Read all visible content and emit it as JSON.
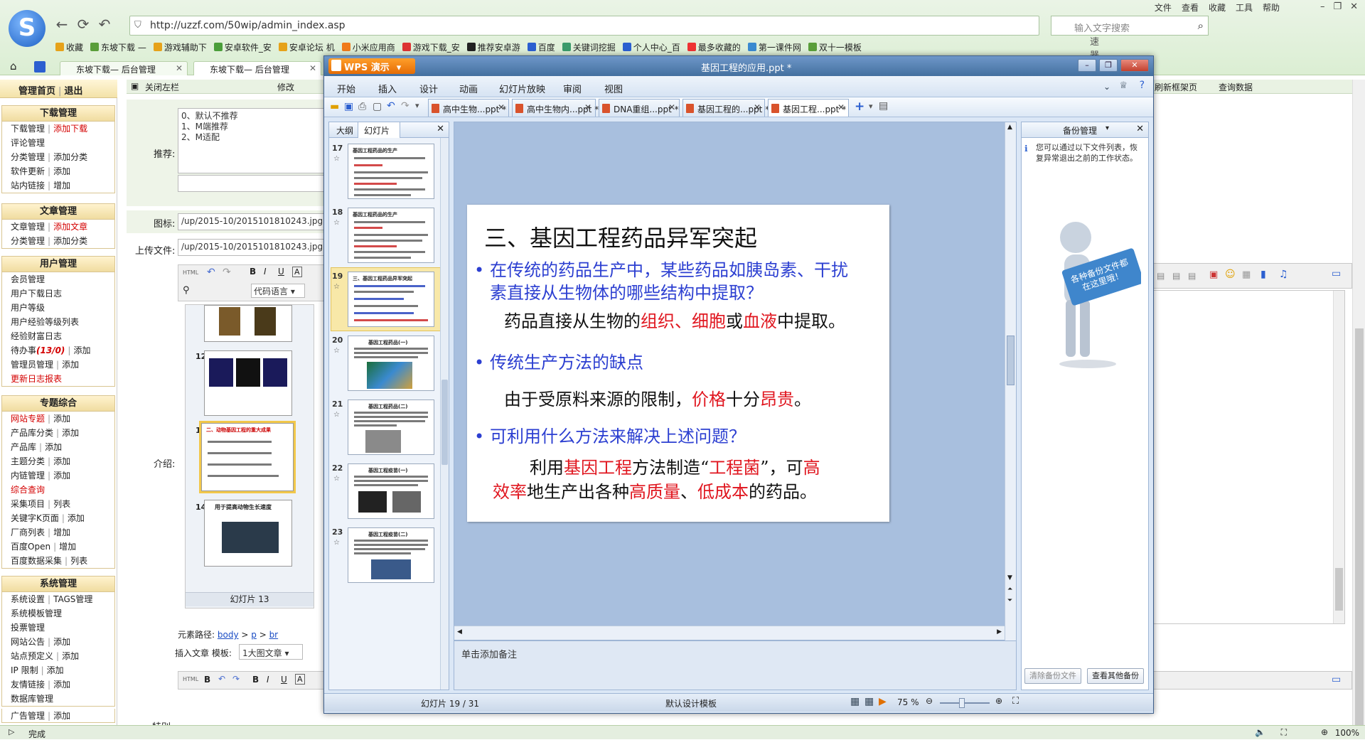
{
  "browser": {
    "address": "http://uzzf.com/50wip/admin_index.asp",
    "accelerator": "加速器",
    "search_placeholder": "输入文字搜索",
    "top_menu": [
      "文件",
      "查看",
      "收藏",
      "工具",
      "帮助"
    ],
    "favorites": [
      "收藏",
      "东坡下载 —",
      "游戏辅助下",
      "安卓软件_安",
      "安卓论坛 机",
      "小米应用商",
      "游戏下载_安",
      "推荐安卓游",
      "百度",
      "关键词挖掘",
      "个人中心_百",
      "最多收藏的",
      "第一课件网",
      "双十一模板"
    ],
    "tabs": [
      "东坡下载— 后台管理",
      "东坡下载— 后台管理"
    ],
    "status": "完成",
    "zoom": "100%"
  },
  "admin": {
    "home": "管理首页",
    "logout": "退出",
    "close_left": "关闭左栏",
    "edit": "修改",
    "refresh_frame": "刷新框架页",
    "query_data": "查询数据",
    "sections": {
      "download": {
        "title": "下载管理",
        "rows": [
          {
            "a": "下载管理",
            "b": "添加下载",
            "b_red": true
          },
          {
            "a": "评论管理",
            "b": ""
          },
          {
            "a": "分类管理",
            "b": "添加分类"
          },
          {
            "a": "软件更新",
            "b": "添加"
          },
          {
            "a": "站内链接",
            "b": "增加"
          }
        ]
      },
      "article": {
        "title": "文章管理",
        "rows": [
          {
            "a": "文章管理",
            "b": "添加文章",
            "b_red": true
          },
          {
            "a": "分类管理",
            "b": "添加分类"
          }
        ]
      },
      "user": {
        "title": "用户管理",
        "rows": [
          {
            "a": "会员管理",
            "b": ""
          },
          {
            "a": "用户下载日志",
            "b": ""
          },
          {
            "a": "用户等级",
            "b": ""
          },
          {
            "a": "用户经验等级列表",
            "b": ""
          },
          {
            "a": "经验财富日志",
            "b": ""
          },
          {
            "a": "待办事",
            "count": "(13/0)",
            "b": "添加"
          },
          {
            "a": "管理员管理",
            "b": "添加"
          },
          {
            "a": "更新日志报表",
            "b": "",
            "a_red": true
          }
        ]
      },
      "topic": {
        "title": "专题综合",
        "rows": [
          {
            "a": "网站专题",
            "b": "添加",
            "a_red": true
          },
          {
            "a": "产品库分类",
            "b": "添加"
          },
          {
            "a": "产品库",
            "b": "添加"
          },
          {
            "a": "主题分类",
            "b": "添加"
          },
          {
            "a": "内链管理",
            "b": "添加"
          },
          {
            "a": "综合查询",
            "b": "",
            "a_red": true
          },
          {
            "a": "采集项目",
            "b": "列表"
          },
          {
            "a": "关键字K页面",
            "b": "添加"
          },
          {
            "a": "厂商列表",
            "b": "增加"
          },
          {
            "a": "百度Open",
            "b": "增加"
          },
          {
            "a": "百度数据采集",
            "b": "列表"
          }
        ]
      },
      "system": {
        "title": "系统管理",
        "rows": [
          {
            "a": "系统设置",
            "b": "TAGS管理"
          },
          {
            "a": "系统模板管理",
            "b": ""
          },
          {
            "a": "投票管理",
            "b": ""
          },
          {
            "a": "网站公告",
            "b": "添加"
          },
          {
            "a": "站点预定义",
            "b": "添加"
          },
          {
            "a": "IP 限制",
            "b": "添加"
          },
          {
            "a": "友情链接",
            "b": "添加"
          },
          {
            "a": "数据库管理",
            "b": ""
          },
          {
            "a": "广告管理",
            "b": "添加"
          }
        ]
      }
    },
    "form": {
      "recommend_label": "推荐:",
      "recommend_options": [
        "0、默认不推荐",
        "1、M端推荐",
        "2、M适配"
      ],
      "icon_label": "图标:",
      "icon_value": "/up/2015-10/2015101810243.jpg",
      "upload_label": "上传文件:",
      "upload_value": "/up/2015-10/2015101810243.jpg",
      "intro_label": "介绍:",
      "code_lang": "代码语言",
      "element_path_label": "元素路径:",
      "element_path": [
        "body",
        "p",
        "br"
      ],
      "insert_template_label": "插入文章 模板:",
      "insert_template_value": "1大图文章",
      "special_label": "特别:",
      "bg_slide_count": "幻灯片 13",
      "bg_slides": [
        {
          "num": "12",
          "title": ""
        },
        {
          "num": "13",
          "title": "二、动物基因工程的重大成果"
        },
        {
          "num": "14",
          "title": "用于提高动物生长速度"
        }
      ]
    }
  },
  "wps": {
    "app_button": "WPS 演示",
    "doc_title": "基因工程的应用.ppt *",
    "menu": [
      "开始",
      "插入",
      "设计",
      "动画",
      "幻灯片放映",
      "审阅",
      "视图"
    ],
    "doc_tabs": [
      "高中生物...ppt *",
      "高中生物内...ppt *",
      "DNA重组...ppt *",
      "基因工程的...ppt *",
      "基因工程...ppt *"
    ],
    "pane_tabs": [
      "大纲",
      "幻灯片"
    ],
    "thumbs": [
      {
        "num": "17",
        "title": "基因工程药品的生产"
      },
      {
        "num": "18",
        "title": "基因工程药品的生产"
      },
      {
        "num": "19",
        "title": "三、基因工程药品异军突起"
      },
      {
        "num": "20",
        "title": "基因工程药品(一)"
      },
      {
        "num": "21",
        "title": "基因工程药品(二)"
      },
      {
        "num": "22",
        "title": "基因工程疫苗(一)"
      },
      {
        "num": "23",
        "title": "基因工程疫苗(二)"
      }
    ],
    "slide": {
      "title": "三、基因工程药品异军突起",
      "q1": "在传统的药品生产中，某些药品如胰岛素、干扰素直接从生物体的哪些结构中提取？",
      "a1": [
        {
          "t": "药品直接从生物的"
        },
        {
          "t": "组织、细胞",
          "r": true
        },
        {
          "t": "或"
        },
        {
          "t": "血液",
          "r": true
        },
        {
          "t": "中提取。"
        }
      ],
      "q2": "传统生产方法的缺点",
      "a2": [
        {
          "t": "由于受原料来源的限制，"
        },
        {
          "t": "价格",
          "r": true
        },
        {
          "t": "十分"
        },
        {
          "t": "昂贵",
          "r": true
        },
        {
          "t": "。"
        }
      ],
      "q3": "可利用什么方法来解决上述问题？",
      "a3_line1": [
        {
          "t": "利用"
        },
        {
          "t": "基因工程",
          "r": true
        },
        {
          "t": "方法制造“"
        },
        {
          "t": "工程菌",
          "r": true
        },
        {
          "t": "”，可"
        },
        {
          "t": "高",
          "r": true
        }
      ],
      "a3_line2": [
        {
          "t": "效率",
          "r": true
        },
        {
          "t": "地生产出各种"
        },
        {
          "t": "高质量",
          "r": true
        },
        {
          "t": "、"
        },
        {
          "t": "低成本",
          "r": true
        },
        {
          "t": "的药品。"
        }
      ]
    },
    "notes": "单击添加备注",
    "backup": {
      "title": "备份管理",
      "tip": "您可以通过以下文件列表，恢复异常退出之前的工作状态。",
      "sign": "各种备份文件都在这里哦！",
      "clear_btn": "清除备份文件",
      "view_btn": "查看其他备份"
    },
    "status": {
      "slide_pos": "幻灯片 19 / 31",
      "template": "默认设计模板",
      "zoom": "75 %"
    }
  }
}
